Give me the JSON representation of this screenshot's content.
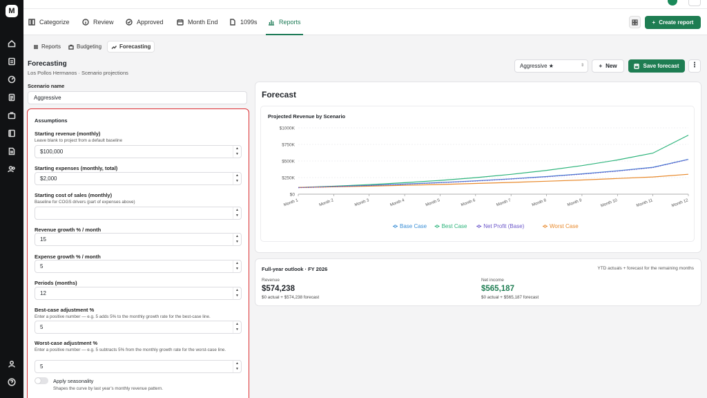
{
  "app": {
    "logo_text": "M"
  },
  "rail": {
    "icons": [
      "home-icon",
      "receipt-icon",
      "gauge-icon",
      "document-icon",
      "briefcase-icon",
      "ledger-icon",
      "file-icon",
      "users-icon",
      "account-icon",
      "help-icon"
    ]
  },
  "tabs": [
    {
      "label": "Categorize",
      "icon": "categorize-icon"
    },
    {
      "label": "Review",
      "icon": "info-icon"
    },
    {
      "label": "Approved",
      "icon": "check-circle-icon"
    },
    {
      "label": "Month End",
      "icon": "calendar-icon"
    },
    {
      "label": "1099s",
      "icon": "file-icon"
    },
    {
      "label": "Reports",
      "icon": "bar-chart-icon",
      "active": true
    }
  ],
  "header_actions": {
    "create_report": "Create report"
  },
  "subnav": [
    {
      "label": "Reports",
      "icon": "list-icon"
    },
    {
      "label": "Budgeting",
      "icon": "briefcase-icon"
    },
    {
      "label": "Forecasting",
      "icon": "trend-icon",
      "active": true
    }
  ],
  "page": {
    "title": "Forecasting",
    "subtitle": "Los Pollos Hermanos · Scenario projections"
  },
  "scenario": {
    "label": "Scenario name",
    "value": "Aggressive"
  },
  "assumptions": {
    "heading": "Assumptions",
    "fields": [
      {
        "label": "Starting revenue (monthly)",
        "help": "Leave blank to project from a default baseline",
        "value": "$100,000"
      },
      {
        "label": "Starting expenses (monthly, total)",
        "help": "",
        "value": "$2,000"
      },
      {
        "label": "Starting cost of sales (monthly)",
        "help": "Baseline for COGS drivers (part of expenses above)",
        "value": ""
      },
      {
        "label": "Revenue growth % / month",
        "help": "",
        "value": "15"
      },
      {
        "label": "Expense growth % / month",
        "help": "",
        "value": "5"
      },
      {
        "label": "Periods (months)",
        "help": "",
        "value": "12"
      },
      {
        "label": "Best-case adjustment %",
        "help": "Enter a positive number — e.g. 5 adds 5% to the monthly growth rate for the best-case line.",
        "value": "5"
      },
      {
        "label": "Worst-case adjustment %",
        "help": "Enter a positive number — e.g. 5 subtracts 5% from the monthly growth rate for the worst-case line.",
        "value": "5"
      }
    ],
    "seasonality": {
      "label": "Apply seasonality",
      "help": "Shapes the curve by last year’s monthly revenue pattern.",
      "enabled": false
    }
  },
  "actions": {
    "selected_scenario": "Aggressive ★",
    "new_label": "New",
    "save_label": "Save forecast"
  },
  "forecast": {
    "title": "Forecast"
  },
  "chart_data": {
    "type": "line",
    "title": "Projected Revenue by Scenario",
    "x": [
      "Month 1",
      "Month 2",
      "Month 3",
      "Month 4",
      "Month 5",
      "Month 6",
      "Month 7",
      "Month 8",
      "Month 9",
      "Month 10",
      "Month 11",
      "Month 12"
    ],
    "yticks": [
      "$0",
      "$250K",
      "$500K",
      "$750K",
      "$1000K"
    ],
    "ylim": [
      0,
      1000000
    ],
    "grid": true,
    "legend_position": "bottom",
    "series": [
      {
        "name": "Base Case",
        "color": "#3b8fd6",
        "values": [
          100000,
          115000,
          132000,
          152000,
          175000,
          201000,
          231000,
          266000,
          306000,
          352000,
          405000,
          525000
        ]
      },
      {
        "name": "Best Case",
        "color": "#2bb37a",
        "values": [
          100000,
          120000,
          144000,
          173000,
          207000,
          249000,
          299000,
          358000,
          430000,
          516000,
          619000,
          890000
        ]
      },
      {
        "name": "Net Profit (Base)",
        "color": "#6a55c9",
        "values": [
          98000,
          112900,
          129800,
          149700,
          172600,
          198400,
          228300,
          262900,
          302600,
          348300,
          401000,
          523000
        ]
      },
      {
        "name": "Worst Case",
        "color": "#e8892b",
        "values": [
          100000,
          110000,
          121000,
          133000,
          146000,
          161000,
          177000,
          195000,
          214000,
          236000,
          259000,
          300000
        ]
      }
    ]
  },
  "outlook": {
    "title": "Full-year outlook · FY 2026",
    "note": "YTD actuals + forecast for the remaining months",
    "revenue": {
      "label": "Revenue",
      "value": "$574,238",
      "detail": "$0 actual + $574,238 forecast"
    },
    "net_income": {
      "label": "Net income",
      "value": "$565,187",
      "detail": "$0 actual + $565,187 forecast"
    }
  }
}
